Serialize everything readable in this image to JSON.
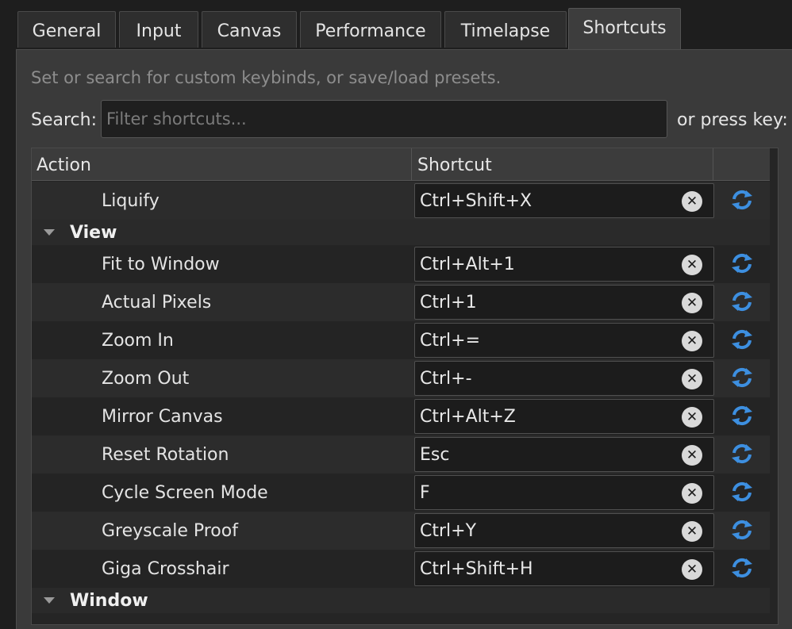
{
  "tabs": [
    {
      "label": "General",
      "active": false
    },
    {
      "label": "Input",
      "active": false
    },
    {
      "label": "Canvas",
      "active": false
    },
    {
      "label": "Performance",
      "active": false
    },
    {
      "label": "Timelapse",
      "active": false
    },
    {
      "label": "Shortcuts",
      "active": true
    }
  ],
  "hint": "Set or search for custom keybinds, or save/load presets.",
  "search": {
    "label": "Search:",
    "placeholder": "Filter shortcuts...",
    "value": "",
    "press_key_label": "or press key:"
  },
  "table": {
    "headers": {
      "action": "Action",
      "shortcut": "Shortcut"
    }
  },
  "rows": [
    {
      "kind": "item",
      "action": "Liquify",
      "shortcut": "Ctrl+Shift+X"
    },
    {
      "kind": "category",
      "label": "View"
    },
    {
      "kind": "item",
      "action": "Fit to Window",
      "shortcut": "Ctrl+Alt+1"
    },
    {
      "kind": "item",
      "action": "Actual Pixels",
      "shortcut": "Ctrl+1"
    },
    {
      "kind": "item",
      "action": "Zoom In",
      "shortcut": "Ctrl+="
    },
    {
      "kind": "item",
      "action": "Zoom Out",
      "shortcut": "Ctrl+-"
    },
    {
      "kind": "item",
      "action": "Mirror Canvas",
      "shortcut": "Ctrl+Alt+Z"
    },
    {
      "kind": "item",
      "action": "Reset Rotation",
      "shortcut": "Esc"
    },
    {
      "kind": "item",
      "action": "Cycle Screen Mode",
      "shortcut": "F"
    },
    {
      "kind": "item",
      "action": "Greyscale Proof",
      "shortcut": "Ctrl+Y"
    },
    {
      "kind": "item",
      "action": "Giga Crosshair",
      "shortcut": "Ctrl+Shift+H"
    },
    {
      "kind": "category",
      "label": "Window"
    }
  ],
  "icons": {
    "clear": "clear-icon",
    "reset": "reset-icon",
    "expand": "expand-triangle-icon"
  },
  "colors": {
    "accent": "#3d8fe0",
    "background": "#1e1e1e",
    "panel": "#3a3a3a"
  }
}
